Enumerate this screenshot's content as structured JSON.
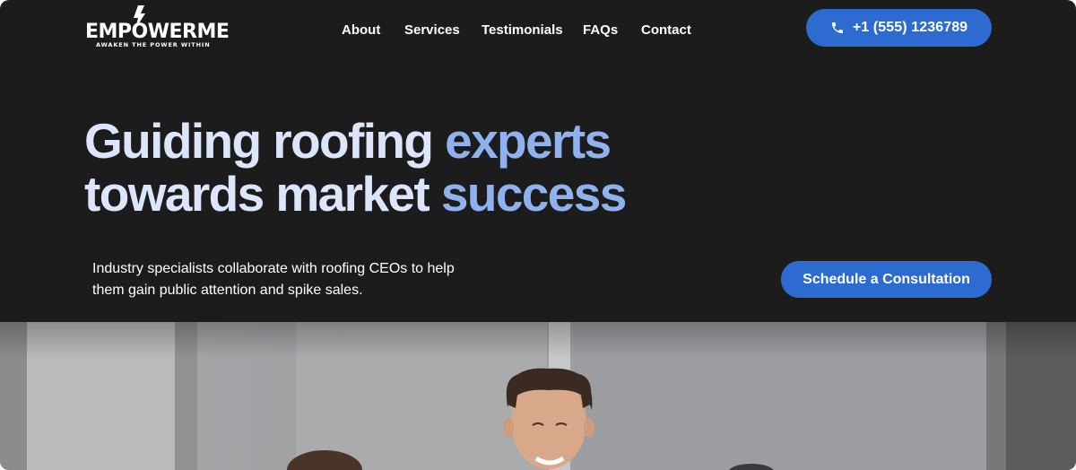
{
  "brand": {
    "name": "EMPOWERME",
    "tagline": "AWAKEN THE POWER WITHIN"
  },
  "nav": {
    "items": [
      {
        "label": "About"
      },
      {
        "label": "Services"
      },
      {
        "label": "Testimonials"
      },
      {
        "label": "FAQs"
      },
      {
        "label": "Contact"
      }
    ]
  },
  "header": {
    "phone_label": "+1 (555) 1236789",
    "phone_icon": "phone-icon"
  },
  "hero": {
    "title_line1_part1": "Guiding roofing ",
    "title_line1_part2": "experts",
    "title_line2_part1": "towards market ",
    "title_line2_part2": "success",
    "description": "Industry specialists collaborate with roofing CEOs to help them gain public attention and spike sales.",
    "cta_label": "Schedule a Consultation"
  },
  "colors": {
    "background": "#1c1c1d",
    "accent": "#2d6bd1",
    "title_light": "#dbe6fb",
    "title_accent": "#8fb2ee"
  }
}
